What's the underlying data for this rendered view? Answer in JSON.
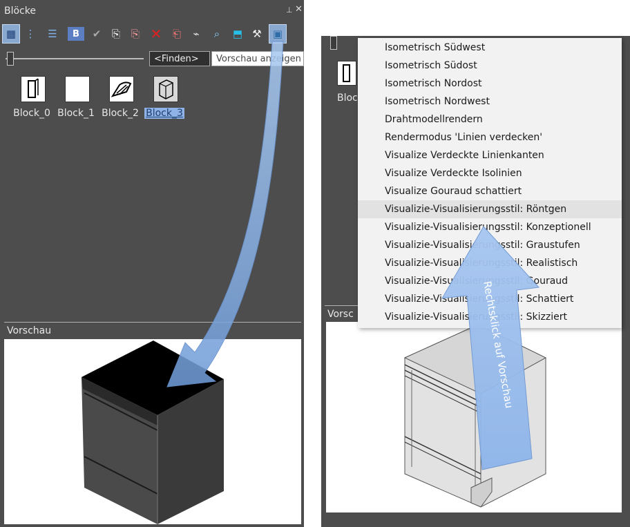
{
  "left_panel": {
    "title": "Blöcke",
    "pin_glyph": "⊥",
    "close_glyph": "✕",
    "toolbar": [
      {
        "icon": "large-icons-view-icon",
        "glyph": "▦"
      },
      {
        "icon": "tree-view-icon",
        "glyph": "⋮"
      },
      {
        "icon": "list-view-icon",
        "glyph": "☰"
      },
      {
        "icon": "block-editor-icon",
        "glyph": "B"
      },
      {
        "icon": "checkmark-icon",
        "glyph": "✔"
      },
      {
        "icon": "copy-block-icon",
        "glyph": "⎘"
      },
      {
        "icon": "delete-copy-icon",
        "glyph": "⎘"
      },
      {
        "icon": "delete-icon",
        "glyph": "✕"
      },
      {
        "icon": "paste-block-icon",
        "glyph": "⎗"
      },
      {
        "icon": "tag-icon",
        "glyph": "⌁"
      },
      {
        "icon": "search-zoom-icon",
        "glyph": "⌕"
      },
      {
        "icon": "insert-block-icon",
        "glyph": "⬒"
      },
      {
        "icon": "tools-icon",
        "glyph": "⚒"
      },
      {
        "icon": "show-preview-icon",
        "glyph": "▣"
      }
    ],
    "find_value": "<Finden>",
    "tooltip": "Vorschau anzeigen",
    "blocks": [
      {
        "label": "Block_0",
        "selected": false
      },
      {
        "label": "Block_1",
        "selected": false
      },
      {
        "label": "Block_2",
        "selected": false
      },
      {
        "label": "Block_3",
        "selected": true
      }
    ],
    "preview_title": "Vorschau"
  },
  "right_panel": {
    "block_label_partial": "Bloc",
    "preview_title_partial": "Vorsc",
    "context_menu": {
      "items": [
        "Isometrisch Südwest",
        "Isometrisch Südost",
        "Isometrisch Nordost",
        "Isometrisch Nordwest",
        "Drahtmodellrendern",
        "Rendermodus 'Linien verdecken'",
        "Visualize Verdeckte Linienkanten",
        "Visualize Verdeckte Isolinien",
        "Visualize Gouraud schattiert",
        "Visualizie-Visualisierungsstil: Röntgen",
        "Visualizie-Visualisierungsstil: Konzeptionell",
        "Visualizie-Visualisierungsstil: Graustufen",
        "Visualizie-Visualisierungsstil: Realistisch",
        "Visualizie-Visualisierungsstil: Gouraud",
        "Visualizie-Visualisierungsstil: Schattiert",
        "Visualizie-Visualisierungsstil: Skizziert"
      ],
      "highlighted_index": 9
    },
    "annotation": "Rechtsklick auf Vorschau"
  },
  "colors": {
    "panel_bg": "#4d4d4d",
    "menu_bg": "#f2f2f2",
    "arrow_blue": "#8fb6e8",
    "selection_blue": "#8fb3e6"
  }
}
